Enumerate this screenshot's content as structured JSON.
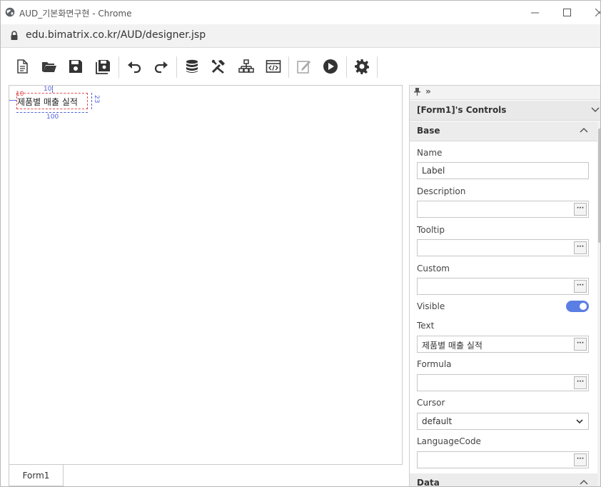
{
  "window": {
    "title": "AUD_기본화면구현 - Chrome",
    "url": "edu.bimatrix.co.kr/AUD/designer.jsp"
  },
  "toolbar": {
    "buttons": [
      {
        "name": "new",
        "icon": "new-document-icon"
      },
      {
        "name": "open",
        "icon": "folder-open-icon"
      },
      {
        "name": "save",
        "icon": "save-icon"
      },
      {
        "name": "save-all",
        "icon": "save-all-icon"
      },
      {
        "name": "undo",
        "icon": "undo-icon"
      },
      {
        "name": "redo",
        "icon": "redo-icon"
      },
      {
        "name": "data-source",
        "icon": "database-icon"
      },
      {
        "name": "tools",
        "icon": "tools-icon"
      },
      {
        "name": "hierarchy",
        "icon": "sitemap-icon"
      },
      {
        "name": "script",
        "icon": "code-window-icon"
      },
      {
        "name": "edit",
        "icon": "edit-icon"
      },
      {
        "name": "run",
        "icon": "play-icon"
      },
      {
        "name": "settings",
        "icon": "gear-icon"
      }
    ]
  },
  "canvas": {
    "label_text": "제품별 매출 실적",
    "guides": {
      "left": "10",
      "top": "10",
      "width": "100",
      "height": "23"
    },
    "tab": "Form1"
  },
  "panel": {
    "controls_title": "[Form1]'s Controls",
    "section_base": "Base",
    "section_data": "Data",
    "props": {
      "name_label": "Name",
      "name_value": "Label",
      "description_label": "Description",
      "description_value": "",
      "tooltip_label": "Tooltip",
      "tooltip_value": "",
      "custom_label": "Custom",
      "custom_value": "",
      "visible_label": "Visible",
      "visible_value": true,
      "text_label": "Text",
      "text_value": "제품별 매출 실적",
      "formula_label": "Formula",
      "formula_value": "",
      "cursor_label": "Cursor",
      "cursor_value": "default",
      "languagecode_label": "LanguageCode",
      "languagecode_value": ""
    },
    "ellipsis": "···"
  },
  "colors": {
    "accent": "#5b7ee5",
    "selection": "#e24a4a",
    "guide": "#4f5fd8"
  }
}
